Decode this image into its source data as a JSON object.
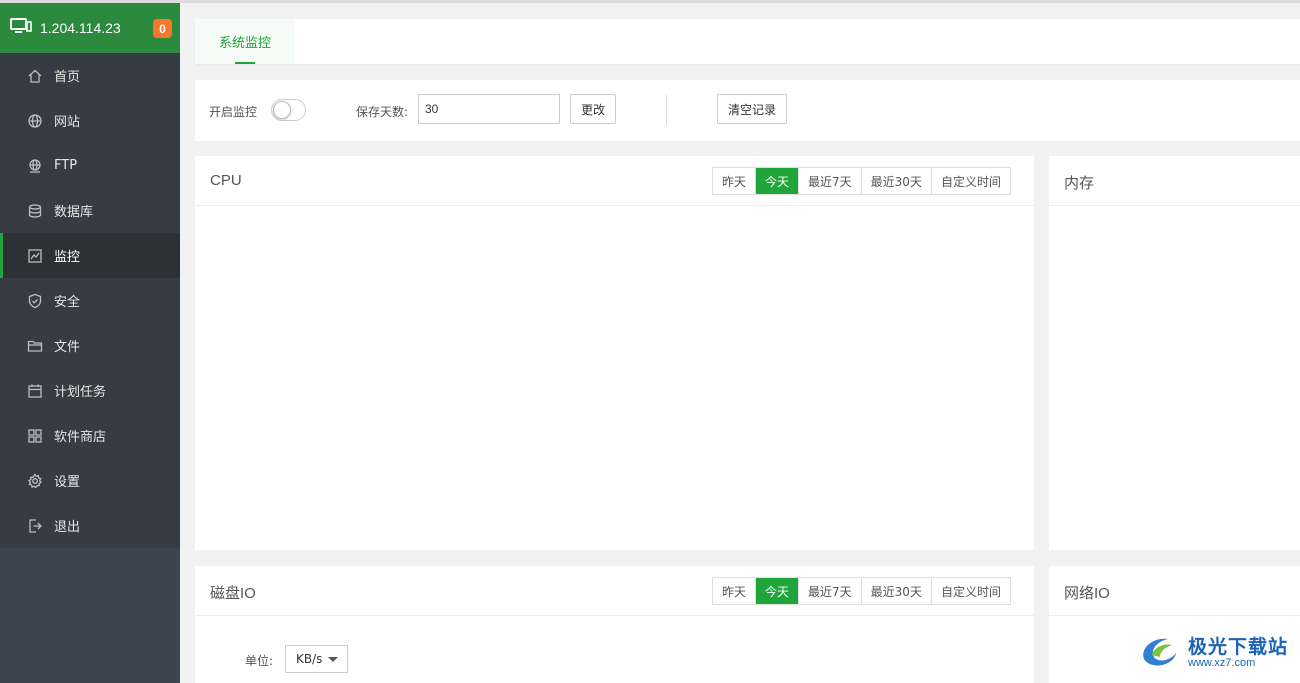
{
  "sidebar": {
    "server_ip": "1.204.114.23",
    "notification_count": "0",
    "items": [
      {
        "label": "首页",
        "icon": "home-icon"
      },
      {
        "label": "网站",
        "icon": "globe-icon"
      },
      {
        "label": "FTP",
        "icon": "ftp-icon"
      },
      {
        "label": "数据库",
        "icon": "database-icon"
      },
      {
        "label": "监控",
        "icon": "monitor-chart-icon",
        "active": true
      },
      {
        "label": "安全",
        "icon": "shield-icon"
      },
      {
        "label": "文件",
        "icon": "folder-icon"
      },
      {
        "label": "计划任务",
        "icon": "calendar-icon"
      },
      {
        "label": "软件商店",
        "icon": "apps-grid-icon"
      },
      {
        "label": "设置",
        "icon": "gear-icon"
      },
      {
        "label": "退出",
        "icon": "logout-icon"
      }
    ]
  },
  "tabs": [
    {
      "label": "系统监控",
      "active": true
    }
  ],
  "toolbar": {
    "enable_label": "开启监控",
    "enabled": false,
    "days_label": "保存天数:",
    "days_value": "30",
    "change_label": "更改",
    "clear_label": "清空记录"
  },
  "range_options": [
    "昨天",
    "今天",
    "最近7天",
    "最近30天",
    "自定义时间"
  ],
  "range_active_index": 1,
  "panels": {
    "cpu": {
      "title": "CPU"
    },
    "memory": {
      "title": "内存"
    },
    "disk": {
      "title": "磁盘IO",
      "unit_label": "单位:",
      "unit_value": "KB/s"
    },
    "network": {
      "title": "网络IO"
    }
  },
  "watermark": {
    "brand": "极光下载站",
    "url": "www.xz7.com"
  },
  "colors": {
    "accent": "#20a53a",
    "sidebar_bg": "#353c44",
    "badge": "#f5772b"
  }
}
